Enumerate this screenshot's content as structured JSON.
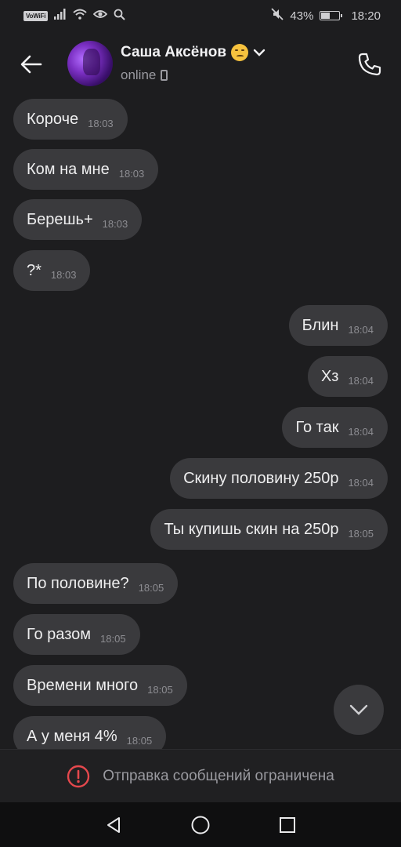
{
  "status_bar": {
    "carrier_badge": "VoWiFi",
    "battery_percent": "43%",
    "battery_level": 0.43,
    "time": "18:20",
    "icons": [
      "signal-icon",
      "wifi-icon",
      "eye-icon",
      "search-icon",
      "mute-icon",
      "battery-icon"
    ]
  },
  "header": {
    "contact_name": "Саша Аксёнов",
    "status": "online",
    "icons": [
      "back-arrow-icon",
      "emoji-icon",
      "chevron-down-icon",
      "device-icon",
      "phone-icon"
    ]
  },
  "messages": [
    {
      "text": "Короче",
      "time": "18:03",
      "direction": "in"
    },
    {
      "text": "Ком на мне",
      "time": "18:03",
      "direction": "in"
    },
    {
      "text": "Берешь+",
      "time": "18:03",
      "direction": "in"
    },
    {
      "text": "?*",
      "time": "18:03",
      "direction": "in"
    },
    {
      "text": "Блин",
      "time": "18:04",
      "direction": "out"
    },
    {
      "text": "Хз",
      "time": "18:04",
      "direction": "out"
    },
    {
      "text": "Го так",
      "time": "18:04",
      "direction": "out"
    },
    {
      "text": "Скину половину 250р",
      "time": "18:04",
      "direction": "out"
    },
    {
      "text": "Ты купишь скин на 250р",
      "time": "18:05",
      "direction": "out"
    },
    {
      "text": "По половине?",
      "time": "18:05",
      "direction": "in"
    },
    {
      "text": "Го разом",
      "time": "18:05",
      "direction": "in"
    },
    {
      "text": "Времени много",
      "time": "18:05",
      "direction": "in"
    },
    {
      "text": "А у меня 4%",
      "time": "18:05",
      "direction": "in"
    }
  ],
  "restricted": {
    "text": "Отправка сообщений ограничена",
    "icon": "alert-circle-icon",
    "icon_color": "#e5484d"
  },
  "nav": {
    "icons": [
      "nav-back-icon",
      "nav-home-icon",
      "nav-recents-icon"
    ]
  }
}
